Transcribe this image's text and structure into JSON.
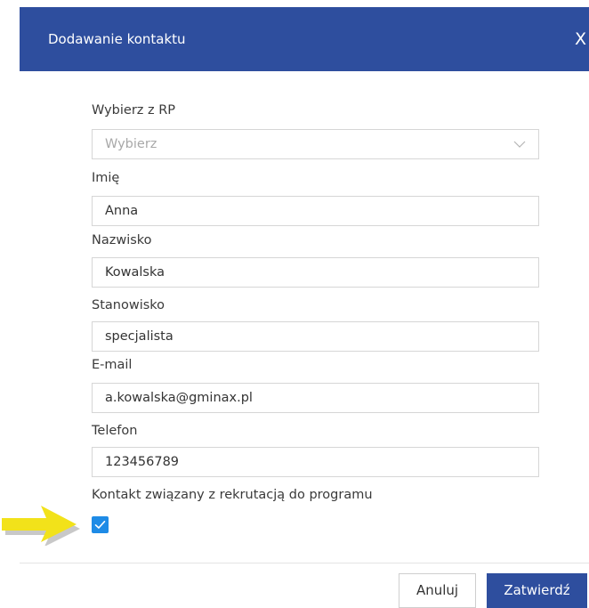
{
  "dialog": {
    "title": "Dodawanie kontaktu",
    "close_label": "X"
  },
  "form": {
    "rp": {
      "label": "Wybierz z RP",
      "placeholder": "Wybierz"
    },
    "first_name": {
      "label": "Imię",
      "value": "Anna"
    },
    "last_name": {
      "label": "Nazwisko",
      "value": "Kowalska"
    },
    "position": {
      "label": "Stanowisko",
      "value": "specjalista"
    },
    "email": {
      "label": "E-mail",
      "value": "a.kowalska@gminax.pl"
    },
    "phone": {
      "label": "Telefon",
      "value": "123456789"
    },
    "recruitment": {
      "label": "Kontakt związany z rekrutacją do programu",
      "checked": true
    }
  },
  "footer": {
    "cancel_label": "Anuluj",
    "confirm_label": "Zatwierdź"
  },
  "colors": {
    "header": "#2e4e9e",
    "checkbox": "#1e8be6",
    "arrow": "#f2e21a"
  },
  "icons": {
    "close": "close-icon",
    "select": "chevron-down-icon",
    "checkbox": "checkmark-icon",
    "annotation": "arrow-right-icon"
  }
}
